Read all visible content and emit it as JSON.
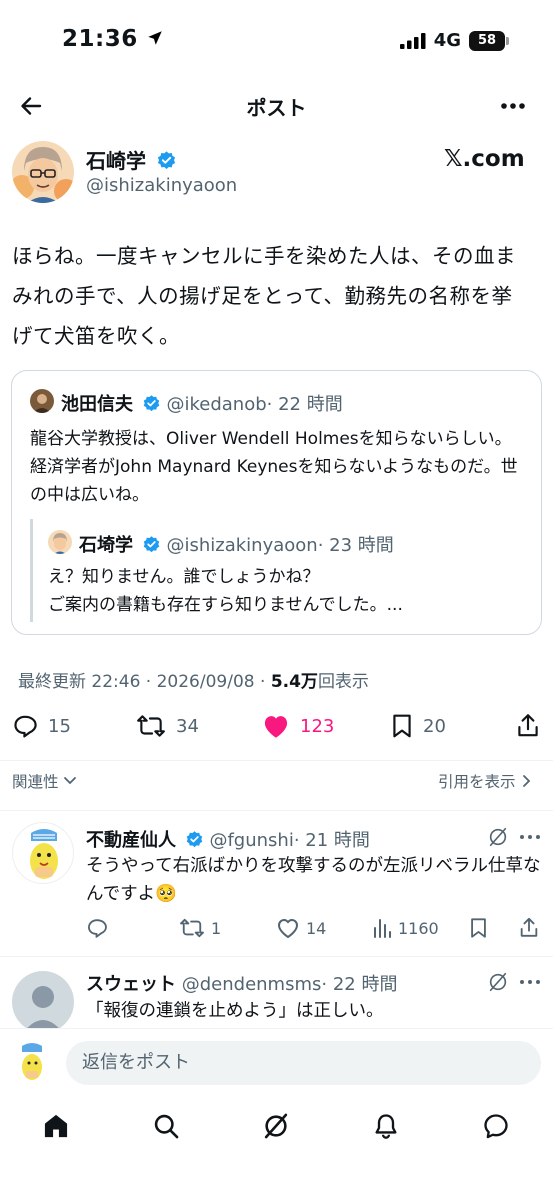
{
  "status_bar": {
    "time": "21:36",
    "network": "4G",
    "battery": "58"
  },
  "header": {
    "title": "ポスト"
  },
  "post": {
    "author_name": "石崎学",
    "author_handle": "@ishizakinyaoon",
    "brand": "𝕏.com",
    "text": "ほらね。一度キャンセルに手を染めた人は、その血まみれの手で、人の揚げ足をとって、勤務先の名称を挙げて犬笛を吹く。",
    "meta_prefix": "最終更新 22:46 · 2026/09/08 · ",
    "views": "5.4万",
    "views_label": "回表示",
    "stats": {
      "replies": "15",
      "reposts": "34",
      "likes": "123",
      "bookmarks": "20"
    }
  },
  "quote": {
    "author_name": "池田信夫",
    "author_handle": "@ikedanob",
    "time": "· 22 時間",
    "text": "龍谷大学教授は、Oliver Wendell Holmesを知らないらしい。経済学者がJohn Maynard Keynesを知らないようなものだ。世の中は広いね。",
    "nested": {
      "author_name": "石埼学",
      "author_handle": "@ishizakinyaoon",
      "time": "· 23 時間",
      "line1": "え？知りません。誰でしょうかね？",
      "line2": "ご案内の書籍も存在すら知りませんでした。..."
    }
  },
  "filters": {
    "relevance": "関連性",
    "show_quotes": "引用を表示"
  },
  "replies": [
    {
      "author_name": "不動産仙人",
      "author_handle": "@fgunshi",
      "time": "· 21 時間",
      "text": "そうやって右派ばかりを攻撃するのが左派リベラル仕草なんですよ🥺",
      "stats": {
        "replies": "",
        "reposts": "1",
        "likes": "14",
        "views": "1160"
      }
    },
    {
      "author_name": "スウェット",
      "author_handle": "@dendenmsms",
      "time": "· 22 時間",
      "text": "「報復の連鎖を止めよう」は正しい。"
    }
  ],
  "composer": {
    "placeholder": "返信をポスト"
  },
  "colors": {
    "like": "#f91880",
    "verified": "#1d9bf0",
    "muted": "#536471"
  }
}
